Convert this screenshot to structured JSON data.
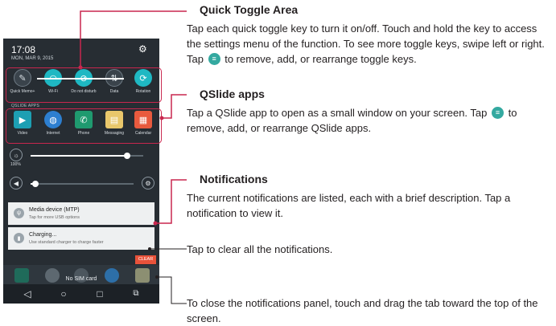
{
  "phone": {
    "time": "17:08",
    "date": "MON, MAR 9, 2015",
    "toggles": [
      {
        "label": "Quick Memo+",
        "icon": "quick-memo-icon",
        "glyph": "✎",
        "active": false
      },
      {
        "label": "Wi-Fi",
        "icon": "wifi-icon",
        "glyph": "◠",
        "active": true
      },
      {
        "label": "Do not disturb",
        "icon": "do-not-disturb-icon",
        "glyph": "⊘",
        "active": true
      },
      {
        "label": "Data",
        "icon": "data-icon",
        "glyph": "⇅",
        "active": false
      },
      {
        "label": "Rotation",
        "icon": "rotation-icon",
        "glyph": "⟳",
        "active": true
      }
    ],
    "qslide_title": "QSLIDE APPS",
    "apps": [
      {
        "label": "Video",
        "icon": "video-icon",
        "glyph": "▶",
        "color": "#1d9fb3"
      },
      {
        "label": "Internet",
        "icon": "internet-icon",
        "glyph": "◍",
        "color": "#2d7fd0"
      },
      {
        "label": "Phone",
        "icon": "phone-icon",
        "glyph": "✆",
        "color": "#1f9a6f"
      },
      {
        "label": "Messaging",
        "icon": "messaging-icon",
        "glyph": "▤",
        "color": "#e9c76b"
      },
      {
        "label": "Calendar",
        "icon": "calendar-icon",
        "glyph": "▦",
        "color": "#e85a3e"
      }
    ],
    "brightness": {
      "label": "100%",
      "icon": "brightness-icon",
      "level": 0.86
    },
    "volume": {
      "icon": "volume-icon",
      "level": 0.05
    },
    "notifications": [
      {
        "title": "Media device (MTP)",
        "subtitle": "Tap for more USB options",
        "icon": "usb-icon"
      },
      {
        "title": "Charging...",
        "subtitle": "Use standard charger to charge faster",
        "icon": "battery-icon"
      }
    ],
    "clear_label": "CLEAR",
    "no_sim": "No SIM card"
  },
  "sections": [
    {
      "heading": "Quick Toggle Area",
      "text_1": "Tap each quick toggle key to turn it on/off. Touch and hold the key to access the settings menu of the function. To see more toggle keys, swipe left or right. Tap",
      "text_2": "to remove, add, or rearrange toggle keys."
    },
    {
      "heading": "QSlide apps",
      "text_1": "Tap a QSlide app to open as a small window on your screen. Tap",
      "text_2": "to remove, add, or rearrange QSlide apps."
    },
    {
      "heading": "Notifications",
      "text_1": "The current notifications are listed, each with a brief description. Tap a notification to view it."
    },
    {
      "text_1": "Tap to clear all the notifications."
    },
    {
      "text_1": "To close the notifications panel, touch and drag the tab toward the top of the screen."
    }
  ],
  "accent_color": "#c8274e"
}
